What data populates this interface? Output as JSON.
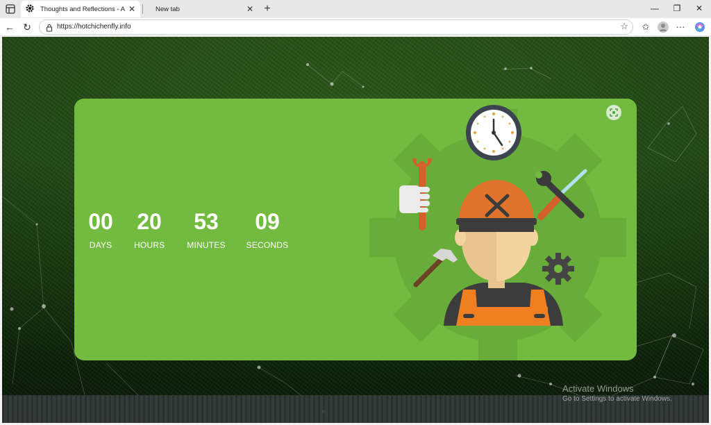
{
  "browser": {
    "tabs": [
      {
        "title": "Thoughts and Reflections - A Pers",
        "active": true
      },
      {
        "title": "New tab",
        "active": false
      }
    ],
    "url": "https://hotchichenfly.info"
  },
  "countdown": {
    "days": {
      "value": "00",
      "label": "DAYS"
    },
    "hours": {
      "value": "20",
      "label": "HOURS"
    },
    "minutes": {
      "value": "53",
      "label": "MINUTES"
    },
    "seconds": {
      "value": "09",
      "label": "SECONDS"
    }
  },
  "watermark": {
    "title": "Activate Windows",
    "subtitle": "Go to Settings to activate Windows."
  },
  "colors": {
    "card": "#72bb40",
    "helmet": "#e0732c",
    "overalls": "#f07f21"
  }
}
